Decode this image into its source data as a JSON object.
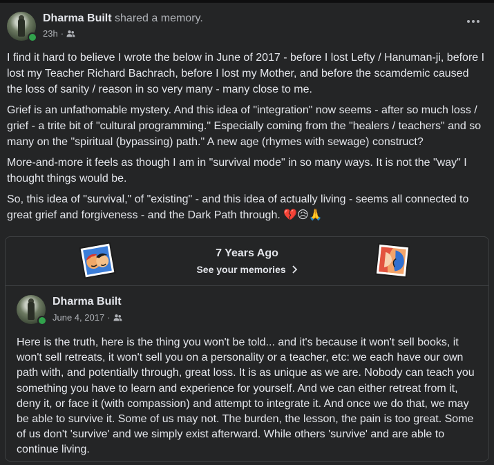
{
  "post": {
    "author": "Dharma Built",
    "action": "shared a memory.",
    "time": "23h",
    "dot": "·",
    "more_icon": "more-horizontal-icon",
    "audience_icon": "friends-icon",
    "paragraphs": [
      "I find it hard to believe I wrote the below in June of 2017 - before I lost Lefty / Hanuman-ji, before I lost my Teacher Richard Bachrach, before I lost my Mother, and before the scamdemic caused the loss of sanity / reason in so very many - many close to me.",
      "Grief is an unfathomable mystery. And this idea of \"integration\" now seems - after so much loss / grief - a trite bit of \"cultural programming.\" Especially coming from the \"healers / teachers\" and so many on the \"spiritual (bypassing) path.\" A new age (rhymes with sewage) construct?",
      "More-and-more it feels as though I am in \"survival mode\" in so many ways. It is not the \"way\" I thought things would be.",
      "So, this idea of \"survival,\" of \"existing\" - and this idea of actually living - seems all connected to great grief and forgiveness - and the Dark Path through. 💔😥🙏"
    ]
  },
  "memory": {
    "title": "7 Years Ago",
    "link": "See your memories",
    "chevron": "›",
    "original": {
      "author": "Dharma Built",
      "date": "June 4, 2017",
      "dot": "·",
      "text": "Here is the truth, here is the thing you won't be told... and it's because it won't sell books, it won't sell retreats, it won't sell you on a personality or a teacher, etc: we each have our own path with, and potentially through, great loss. It is as unique as we are. Nobody can teach you something you have to learn and experience for yourself. And we can either retreat from it, deny it, or face it (with compassion) and attempt to integrate it. And once we do that, we may be able to survive it. Some of us may not. The burden, the lesson, the pain is too great. Some of us don't 'survive' and we simply exist afterward. While others 'survive' and are able to continue living."
    }
  },
  "colors": {
    "background": "#242526",
    "text": "#e4e6eb",
    "secondary_text": "#b0b3b8",
    "online": "#31a24c",
    "border": "#3e4042"
  }
}
